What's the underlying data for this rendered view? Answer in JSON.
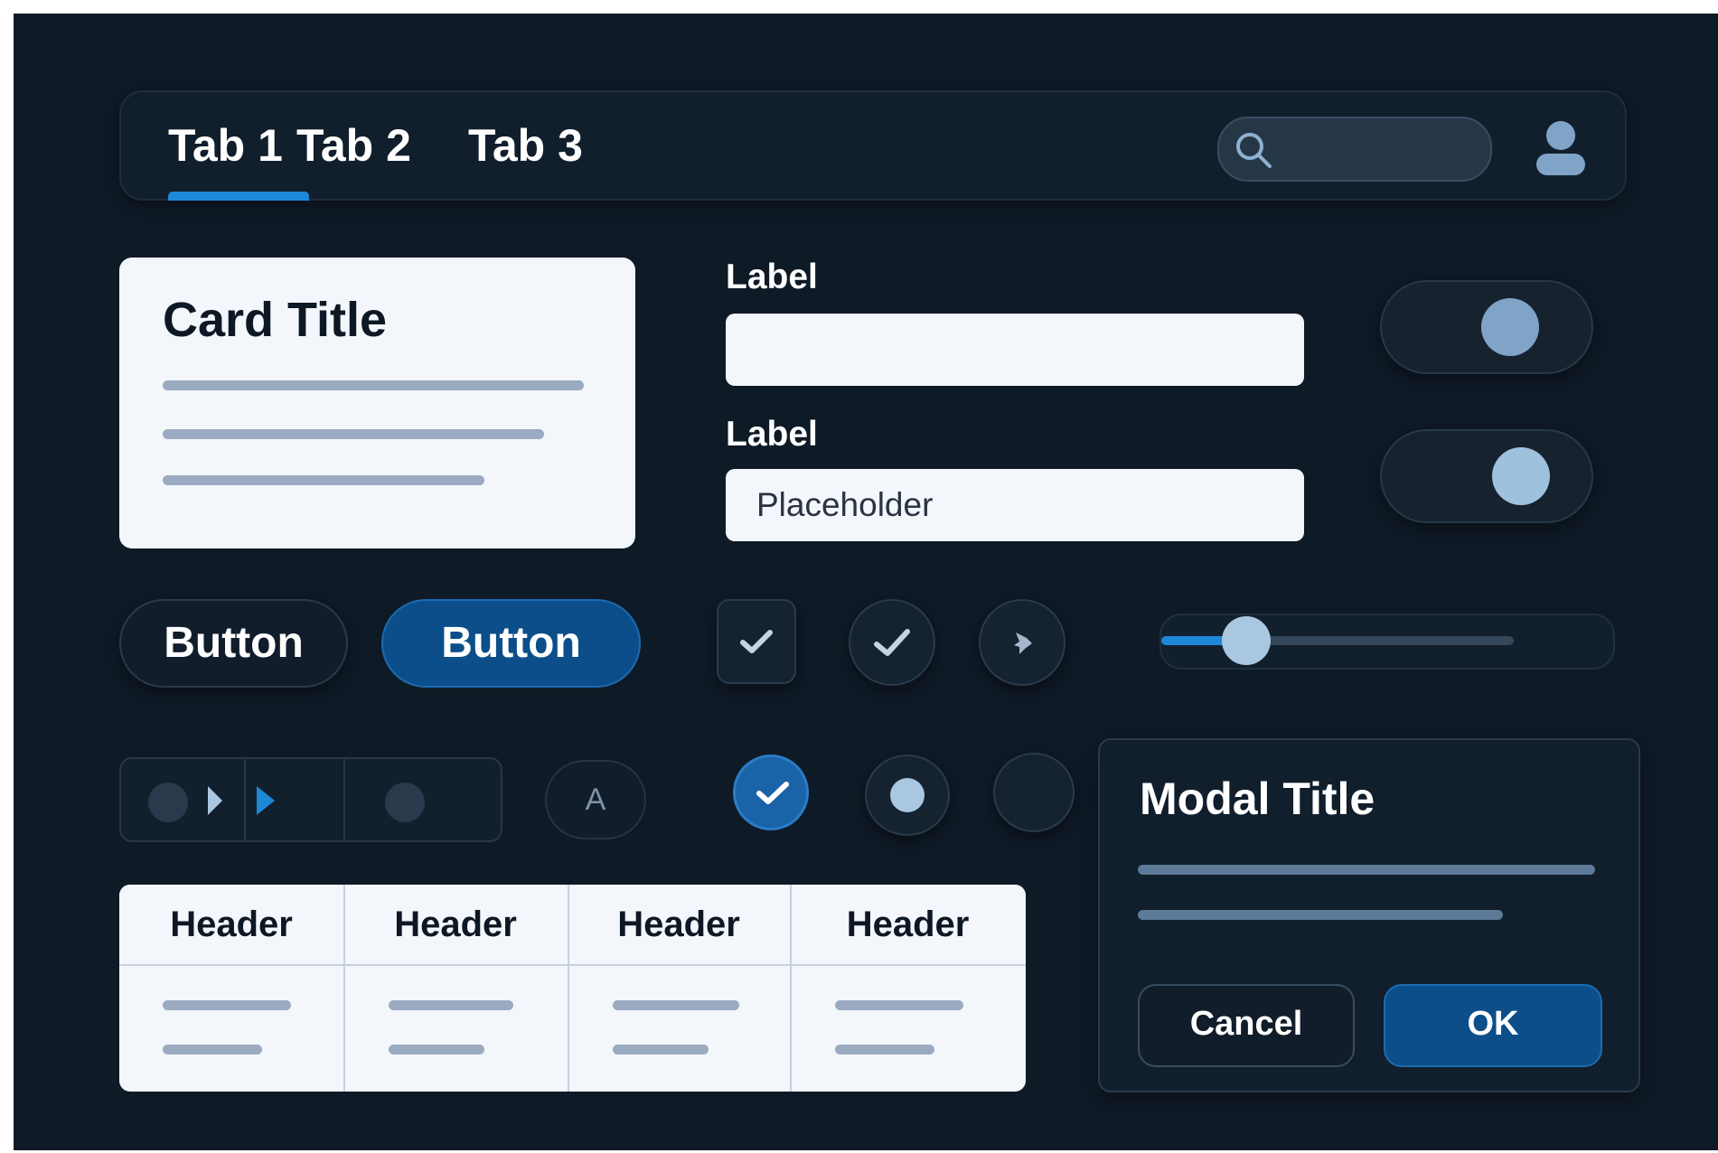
{
  "tabs": [
    {
      "label": "Tab 1",
      "active": true
    },
    {
      "label": "Tab 2",
      "active": false
    },
    {
      "label": "Tab 3",
      "active": false
    }
  ],
  "search": {
    "placeholder": "",
    "icon": "search-icon"
  },
  "user": {
    "icon": "user-icon"
  },
  "card": {
    "title": "Card Title"
  },
  "form": {
    "field1": {
      "label": "Label",
      "value": "",
      "placeholder": ""
    },
    "field2": {
      "label": "Label",
      "placeholder": "Placeholder"
    }
  },
  "buttons": {
    "secondary_label": "Button",
    "primary_label": "Button"
  },
  "slider": {
    "value": 0.24
  },
  "letter_button": {
    "label": "A"
  },
  "table": {
    "headers": [
      "Header",
      "Header",
      "Header",
      "Header"
    ]
  },
  "modal": {
    "title": "Modal Title",
    "cancel_label": "Cancel",
    "ok_label": "OK"
  },
  "colors": {
    "background": "#0f1a27",
    "accent": "#1e88d8",
    "primary": "#0b4e8a",
    "surface": "#f3f6fa"
  }
}
